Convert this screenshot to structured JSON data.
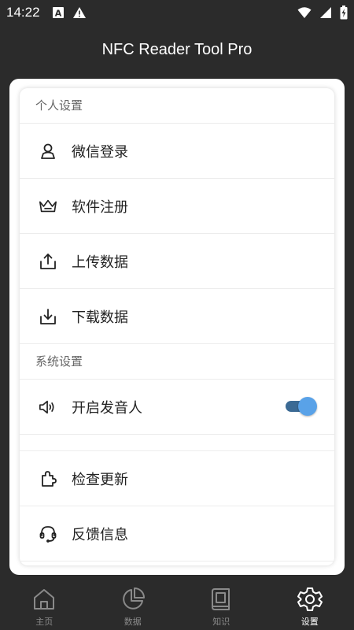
{
  "status_bar": {
    "time": "14:22"
  },
  "app": {
    "title": "NFC Reader Tool Pro"
  },
  "sections": [
    {
      "header": "个人设置",
      "items": [
        {
          "label": "微信登录",
          "icon": "user-icon"
        },
        {
          "label": "软件注册",
          "icon": "crown-icon"
        },
        {
          "label": "上传数据",
          "icon": "upload-icon"
        },
        {
          "label": "下载数据",
          "icon": "download-icon"
        }
      ]
    },
    {
      "header": "系统设置",
      "items": [
        {
          "label": "开启发音人",
          "icon": "speaker-icon",
          "toggle": true
        },
        {
          "label": "检查更新",
          "icon": "puzzle-icon"
        },
        {
          "label": "反馈信息",
          "icon": "headset-icon"
        }
      ]
    }
  ],
  "bottom_nav": [
    {
      "label": "主页",
      "icon": "home-icon",
      "active": false
    },
    {
      "label": "数据",
      "icon": "pie-chart-icon",
      "active": false
    },
    {
      "label": "知识",
      "icon": "book-icon",
      "active": false
    },
    {
      "label": "设置",
      "icon": "gear-icon",
      "active": true
    }
  ],
  "colors": {
    "background": "#2b2b2b",
    "toggle_track": "#3b6a94",
    "toggle_knob": "#59a2e8"
  }
}
